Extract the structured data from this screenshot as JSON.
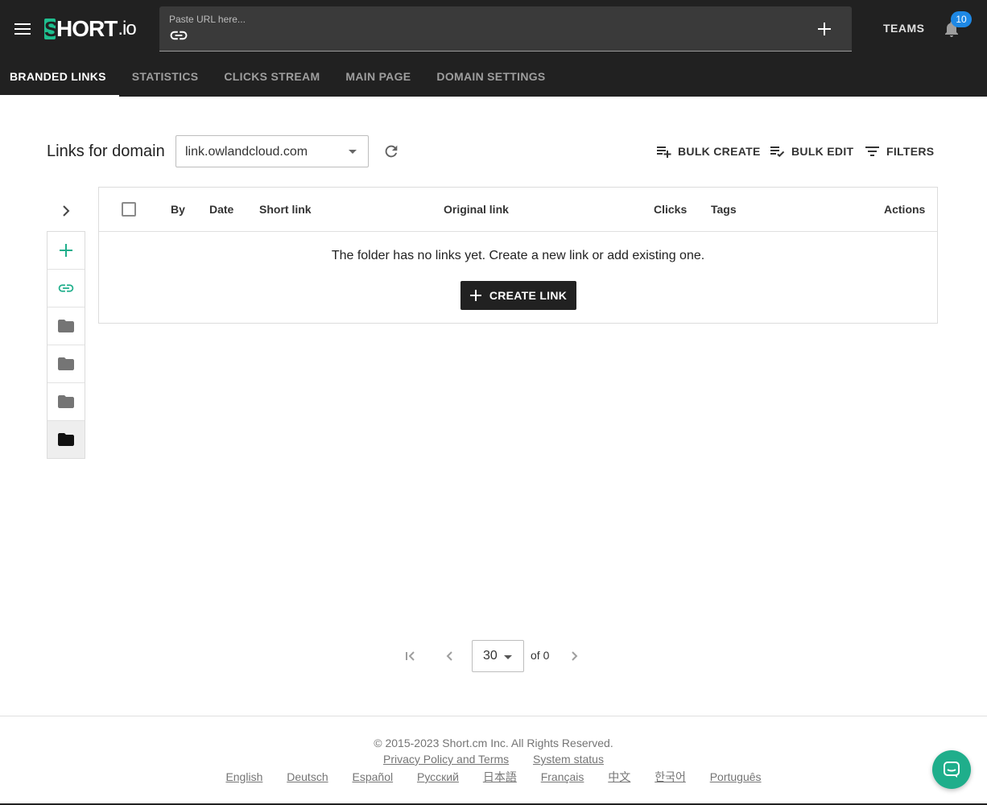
{
  "header": {
    "logo_main": "HORT",
    "logo_s": "S",
    "logo_tld": ".io",
    "url_placeholder": "Paste URL here...",
    "teams_label": "TEAMS",
    "notification_count": "10",
    "accent_color": "#1fbf8f"
  },
  "nav": {
    "tabs": [
      {
        "label": "BRANDED LINKS",
        "active": true
      },
      {
        "label": "STATISTICS",
        "active": false
      },
      {
        "label": "CLICKS STREAM",
        "active": false
      },
      {
        "label": "MAIN PAGE",
        "active": false
      },
      {
        "label": "DOMAIN SETTINGS",
        "active": false
      }
    ]
  },
  "toolbar": {
    "title": "Links for domain",
    "domain_value": "link.owlandcloud.com",
    "bulk_create_label": "BULK CREATE",
    "bulk_edit_label": "BULK EDIT",
    "filters_label": "FILTERS"
  },
  "folders": {
    "icons": [
      "plus-icon",
      "link-icon",
      "folder-icon",
      "folder-icon",
      "folder-icon",
      "folder-icon"
    ]
  },
  "table": {
    "columns": {
      "by": "By",
      "date": "Date",
      "short_link": "Short link",
      "original_link": "Original link",
      "clicks": "Clicks",
      "tags": "Tags",
      "actions": "Actions"
    },
    "empty_message": "The folder has no links yet. Create a new link or add existing one.",
    "create_link_label": "CREATE LINK"
  },
  "pagination": {
    "page_size": "30",
    "of_label": "of 0"
  },
  "footer": {
    "copyright": "© 2015-2023  Short.cm Inc. All Rights Reserved.",
    "privacy_label": "Privacy Policy and Terms",
    "status_label": "System status",
    "languages": [
      "English",
      "Deutsch",
      "Español",
      "Русский",
      "日本語",
      "Français",
      "中文",
      "한국어",
      "Português"
    ]
  }
}
